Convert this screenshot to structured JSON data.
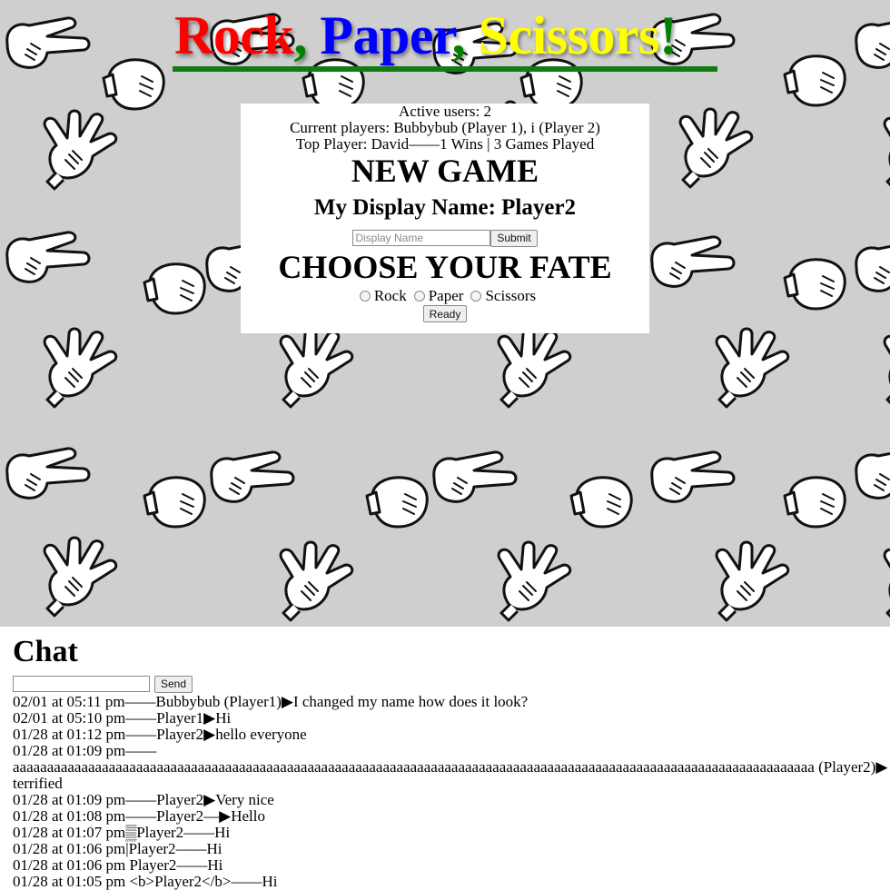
{
  "title": {
    "words": [
      {
        "text": "Rock",
        "color": "#ff0000"
      },
      {
        "text": ", ",
        "color": "#008000"
      },
      {
        "text": "Paper",
        "color": "#0000ff"
      },
      {
        "text": ", ",
        "color": "#008000"
      },
      {
        "text": "Scissors",
        "color": "#ffff00"
      },
      {
        "text": "!",
        "color": "#008000"
      }
    ],
    "underline_color": "#147a14"
  },
  "status": {
    "active_users": "Active users: 2",
    "current_players": "Current players: Bubbybub (Player 1), i (Player 2)",
    "top_player": "Top Player: David——1 Wins | 3 Games Played"
  },
  "game": {
    "new_game_heading": "NEW GAME",
    "display_name_heading": "My Display Name: Player2",
    "name_placeholder": "Display Name",
    "submit_label": "Submit",
    "choose_heading": "CHOOSE YOUR FATE",
    "choices": [
      "Rock",
      "Paper",
      "Scissors"
    ],
    "ready_label": "Ready"
  },
  "chat": {
    "heading": "Chat",
    "input_value": "",
    "send_label": "Send",
    "messages": [
      "02/01 at 05:11 pm——Bubbybub (Player1)▶I changed my name how does it look?",
      "02/01 at 05:10 pm——Player1▶Hi",
      "01/28 at 01:12 pm——Player2▶hello everyone",
      "01/28 at 01:09 pm——",
      "aaaaaaaaaaaaaaaaaaaaaaaaaaaaaaaaaaaaaaaaaaaaaaaaaaaaaaaaaaaaaaaaaaaaaaaaaaaaaaaaaaaaaaaaaaaaaaaaaaaaaaaaaaaaaaaaaaaaa (Player2)▶terrified",
      "01/28 at 01:09 pm——Player2▶Very nice",
      "01/28 at 01:08 pm——Player2—▶Hello",
      "01/28 at 01:07 pm▒Player2——Hi",
      "01/28 at 01:06 pm|Player2——Hi",
      "01/28 at 01:06 pm Player2——Hi",
      "01/28 at 01:05 pm <b>Player2</b>——Hi"
    ]
  },
  "icons": {
    "background_tile": "hand-gesture-icon"
  }
}
